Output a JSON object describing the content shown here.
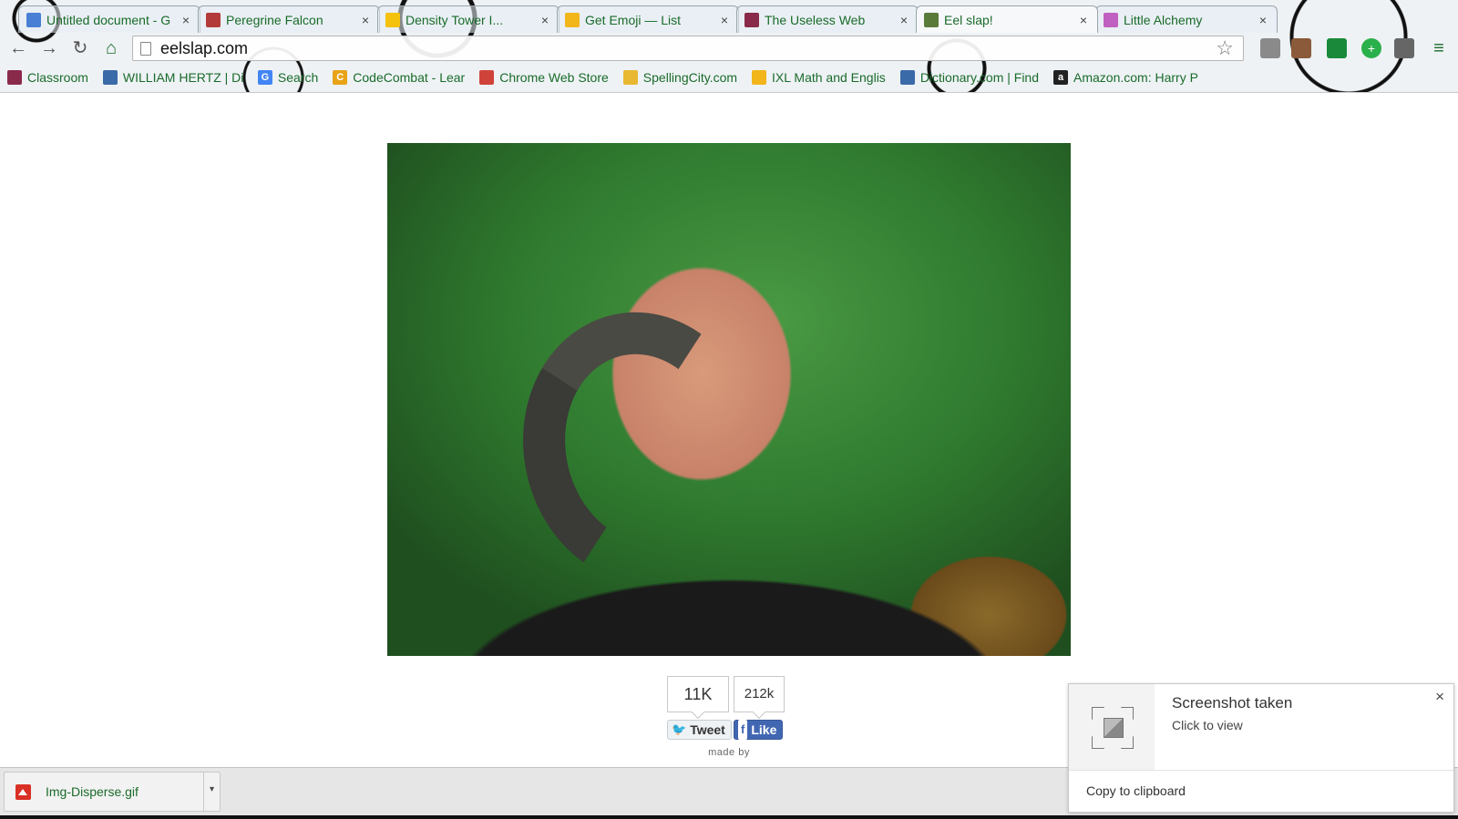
{
  "tabs": [
    {
      "title": "Untitled document - G",
      "favicon_color": "#4a7fd6",
      "active": false
    },
    {
      "title": "Peregrine Falcon",
      "favicon_color": "#b33a3a",
      "active": false
    },
    {
      "title": "Density Tower I...",
      "favicon_color": "#f4c20d",
      "active": false
    },
    {
      "title": "Get Emoji — List",
      "favicon_color": "#f2b61b",
      "active": false
    },
    {
      "title": "The Useless Web",
      "favicon_color": "#8a2a4a",
      "active": false
    },
    {
      "title": "Eel slap!",
      "favicon_color": "#5a7a3a",
      "active": true
    },
    {
      "title": "Little Alchemy",
      "favicon_color": "#c060c0",
      "active": false
    }
  ],
  "toolbar": {
    "back_icon": "←",
    "forward_icon": "→",
    "reload_icon": "↻",
    "home_icon": "⌂",
    "url": "eelslap.com",
    "star_icon": "☆"
  },
  "bookmarks": [
    {
      "label": "Classroom",
      "icon_color": "#8a2a4a"
    },
    {
      "label": "WILLIAM HERTZ | Di",
      "icon_color": "#3a6aa8"
    },
    {
      "label": "Search",
      "icon_color": "#4285f4",
      "glyph": "G"
    },
    {
      "label": "CodeCombat - Lear",
      "icon_color": "#e8a317",
      "glyph": "C"
    },
    {
      "label": "Chrome Web Store",
      "icon_color": "#d0433a"
    },
    {
      "label": "SpellingCity.com",
      "icon_color": "#e8b830"
    },
    {
      "label": "IXL Math and Englis",
      "icon_color": "#f2b61b"
    },
    {
      "label": "Dictionary.com | Find",
      "icon_color": "#3a6aa8"
    },
    {
      "label": "Amazon.com: Harry P",
      "icon_color": "#222",
      "glyph": "a"
    }
  ],
  "social": {
    "tweet_count": "11K",
    "like_count": "212k",
    "tweet_label": "Tweet",
    "like_label": "Like",
    "made_by": "made by"
  },
  "download": {
    "filename": "Img-Disperse.gif",
    "menu_icon": "▾"
  },
  "notification": {
    "title": "Screenshot taken",
    "subtitle": "Click to view",
    "action": "Copy to clipboard",
    "close_icon": "×"
  }
}
